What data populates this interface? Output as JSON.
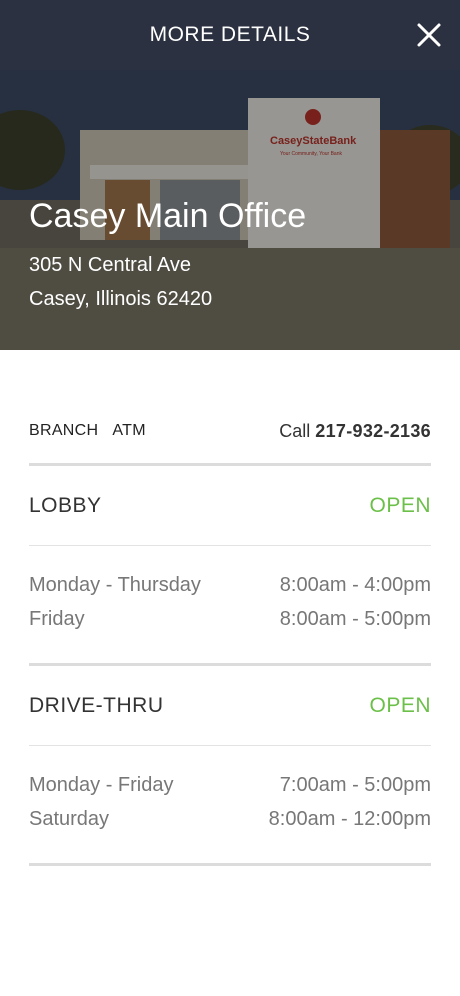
{
  "header": {
    "title": "MORE DETAILS",
    "close_icon": "close-icon"
  },
  "hero": {
    "name": "Casey Main Office",
    "address_line1": "305 N Central Ave",
    "address_line2": "Casey, Illinois 62420",
    "sign_text": "CaseyStateBank",
    "sign_tagline": "Your Community, Your Bank"
  },
  "types": {
    "branch": "BRANCH",
    "atm": "ATM"
  },
  "call": {
    "prefix": "Call",
    "number": "217-932-2136"
  },
  "lobby": {
    "title": "LOBBY",
    "status": "OPEN",
    "hours": [
      {
        "days": "Monday - Thursday",
        "time": "8:00am - 4:00pm"
      },
      {
        "days": "Friday",
        "time": "8:00am - 5:00pm"
      }
    ]
  },
  "drive_thru": {
    "title": "DRIVE-THRU",
    "status": "OPEN",
    "hours": [
      {
        "days": "Monday - Friday",
        "time": "7:00am - 5:00pm"
      },
      {
        "days": "Saturday",
        "time": "8:00am - 12:00pm"
      }
    ]
  },
  "colors": {
    "header_bg": "#2b3140",
    "open_green": "#6cc04a",
    "divider": "#dcdcdc"
  }
}
